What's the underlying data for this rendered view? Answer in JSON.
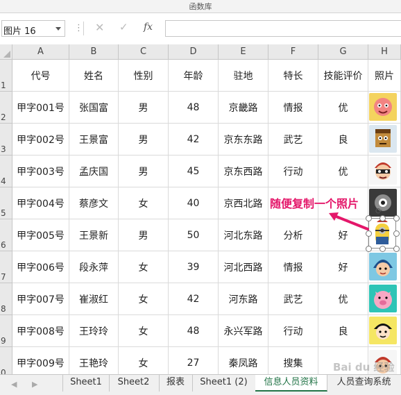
{
  "ribbon": {
    "group_label": "函数库"
  },
  "formula_bar": {
    "name_box": "图片 16",
    "cancel_icon": "✕",
    "enter_icon": "✓",
    "fx_label": "fx",
    "formula": ""
  },
  "columns": [
    "A",
    "B",
    "C",
    "D",
    "E",
    "F",
    "G",
    "H"
  ],
  "rows": [
    "1",
    "2",
    "3",
    "4",
    "5",
    "6",
    "7",
    "8",
    "9",
    "0"
  ],
  "table": {
    "headers": [
      "代号",
      "姓名",
      "性别",
      "年龄",
      "驻地",
      "特长",
      "技能评价",
      "照片"
    ],
    "rows": [
      [
        "甲字001号",
        "张国富",
        "男",
        "48",
        "京畿路",
        "情报",
        "优"
      ],
      [
        "甲字002号",
        "王景富",
        "男",
        "42",
        "京东东路",
        "武艺",
        "良"
      ],
      [
        "甲字003号",
        "孟庆国",
        "男",
        "45",
        "京东西路",
        "行动",
        "优"
      ],
      [
        "甲字004号",
        "蔡彦文",
        "女",
        "40",
        "京西北路",
        "",
        ""
      ],
      [
        "甲字005号",
        "王景新",
        "男",
        "50",
        "河北东路",
        "分析",
        "好"
      ],
      [
        "甲字006号",
        "段永萍",
        "女",
        "39",
        "河北西路",
        "情报",
        "好"
      ],
      [
        "甲字007号",
        "崔淑红",
        "女",
        "42",
        "河东路",
        "武艺",
        "优"
      ],
      [
        "甲字008号",
        "王玲玲",
        "女",
        "48",
        "永兴军路",
        "行动",
        "良"
      ],
      [
        "甲字009号",
        "王艳玲",
        "女",
        "27",
        "秦凤路",
        "搜集",
        ""
      ]
    ]
  },
  "annotation": {
    "text": "随便复制一个照片"
  },
  "sheet_tabs": [
    "Sheet1",
    "Sheet2",
    "报表",
    "Sheet1 (2)",
    "信息人员资料",
    "人员查询系统"
  ],
  "active_tab": "信息人员资料",
  "watermark": "Bai du 经验",
  "colors": {
    "annotation": "#e4176a",
    "active_tab": "#217346"
  }
}
